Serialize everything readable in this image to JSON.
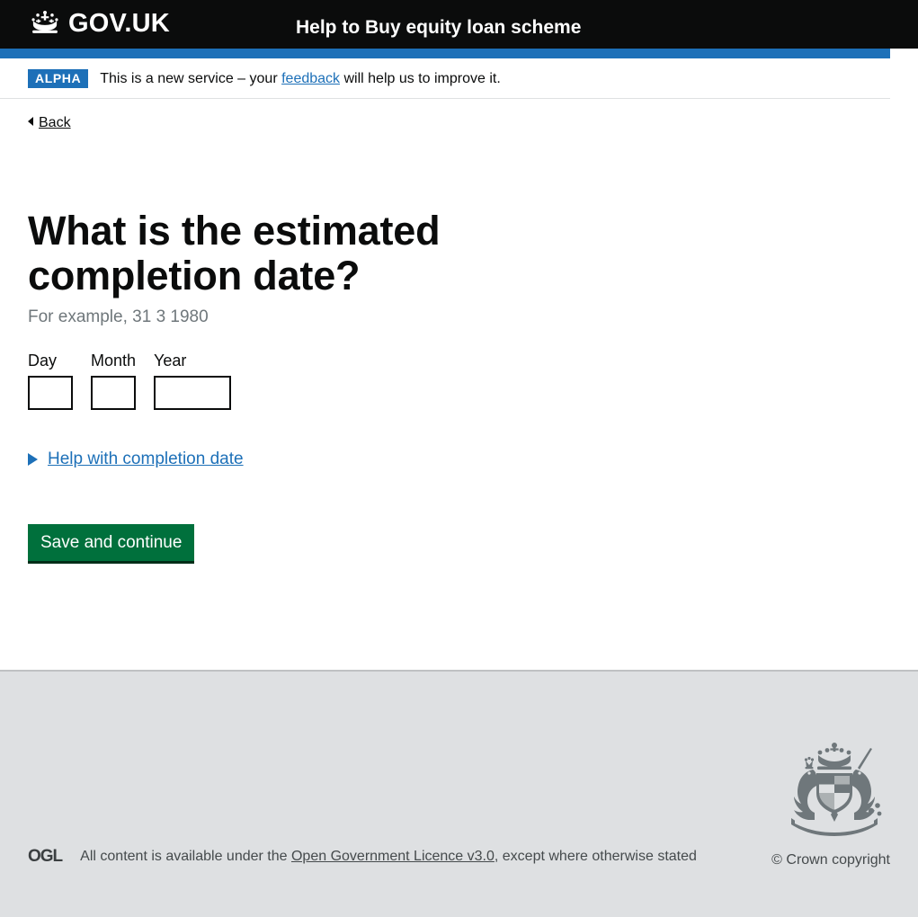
{
  "header": {
    "logo_text": "GOV.UK",
    "crown_icon": "crown-icon",
    "service_name": "Help to Buy equity loan scheme"
  },
  "phase_banner": {
    "tag": "ALPHA",
    "text_before": "This is a new service – your ",
    "link_label": "feedback",
    "text_after": " will help us to improve it."
  },
  "back_link": {
    "label": "Back",
    "icon": "chevron-left-icon"
  },
  "main": {
    "heading": "What is the estimated completion date?",
    "hint": "For example, 31 3 1980",
    "date_inputs": [
      {
        "label": "Day",
        "value": "",
        "width": "2"
      },
      {
        "label": "Month",
        "value": "",
        "width": "2"
      },
      {
        "label": "Year",
        "value": "",
        "width": "4"
      }
    ],
    "details_summary": "Help with completion date",
    "details_icon": "triangle-right-icon",
    "submit_label": "Save and continue"
  },
  "footer": {
    "ogl_logo": "OGL",
    "licence_before": "All content is available under the ",
    "licence_link": "Open Government Licence v3.0",
    "licence_after": ", except where otherwise stated",
    "crown_copyright": "© Crown copyright",
    "coat_of_arms_icon": "royal-coat-of-arms-icon"
  },
  "colors": {
    "header_black": "#0b0c0c",
    "govuk_blue": "#1d70b8",
    "button_green": "#00703c",
    "footer_grey": "#dee0e2",
    "hint_grey": "#6f777b"
  }
}
